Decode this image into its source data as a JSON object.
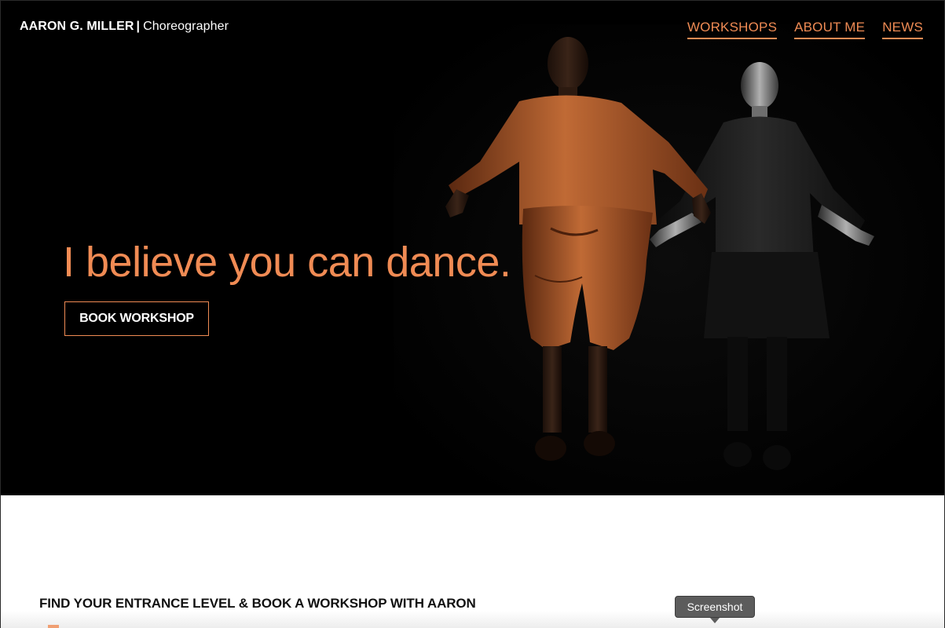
{
  "header": {
    "brand_name": "AARON G. MILLER",
    "brand_separator": "|",
    "brand_role": "Choreographer"
  },
  "nav": {
    "items": [
      {
        "label": "WORKSHOPS"
      },
      {
        "label": "ABOUT ME"
      },
      {
        "label": "NEWS"
      }
    ]
  },
  "hero": {
    "headline": "I believe you can dance.",
    "cta_label": "BOOK WORKSHOP",
    "image_icon": "dancers-photo"
  },
  "section": {
    "title": "FIND YOUR ENTRANCE LEVEL & BOOK A WORKSHOP WITH AARON"
  },
  "tooltip": {
    "label": "Screenshot"
  },
  "colors": {
    "accent": "#f08b54",
    "hero_background": "#000000",
    "text_on_dark": "#ffffff",
    "body_text": "#111111",
    "tooltip_background": "#5c5c5c"
  }
}
